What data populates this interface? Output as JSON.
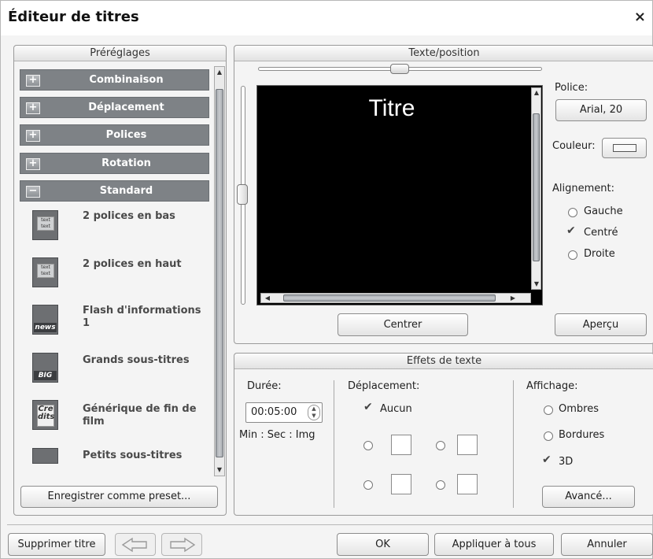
{
  "dialog": {
    "title": "Éditeur de titres",
    "close": "×"
  },
  "presets": {
    "heading": "Préréglages",
    "categories": [
      {
        "label": "Combinaison",
        "sign": "+"
      },
      {
        "label": "Déplacement",
        "sign": "+"
      },
      {
        "label": "Polices",
        "sign": "+"
      },
      {
        "label": "Rotation",
        "sign": "+"
      },
      {
        "label": "Standard",
        "sign": "−"
      }
    ],
    "items": [
      {
        "label": "2 polices en bas",
        "thumb": "text text",
        "tag": ""
      },
      {
        "label": "2 polices en haut",
        "thumb": "text text",
        "tag": ""
      },
      {
        "label": "Flash d'informations 1",
        "thumb": "",
        "tag": "news"
      },
      {
        "label": "Grands sous-titres",
        "thumb": "",
        "tag": "BIG"
      },
      {
        "label": "Générique de fin de film",
        "thumb": "Cre dits",
        "tag": ""
      },
      {
        "label": "Petits sous-titres",
        "thumb": "",
        "tag": ""
      }
    ],
    "save_button": "Enregistrer comme preset..."
  },
  "text_position": {
    "heading": "Texte/position",
    "preview_text": "Titre",
    "font_label": "Police:",
    "font_value": "Arial, 20",
    "color_label": "Couleur:",
    "align_label": "Alignement:",
    "align_options": [
      "Gauche",
      "Centré",
      "Droite"
    ],
    "align_selected": "Centré",
    "center_button": "Centrer",
    "preview_button": "Aperçu"
  },
  "effects": {
    "heading": "Effets de texte",
    "duration_label": "Durée:",
    "duration_value": "00:05:00",
    "duration_format": "Min : Sec : Img",
    "movement_label": "Déplacement:",
    "movement_none": "Aucun",
    "display_label": "Affichage:",
    "display_options": [
      "Ombres",
      "Bordures",
      "3D"
    ],
    "advanced_button": "Avancé..."
  },
  "footer": {
    "delete_button": "Supprimer titre",
    "ok_button": "OK",
    "apply_all_button": "Appliquer à tous",
    "cancel_button": "Annuler"
  }
}
